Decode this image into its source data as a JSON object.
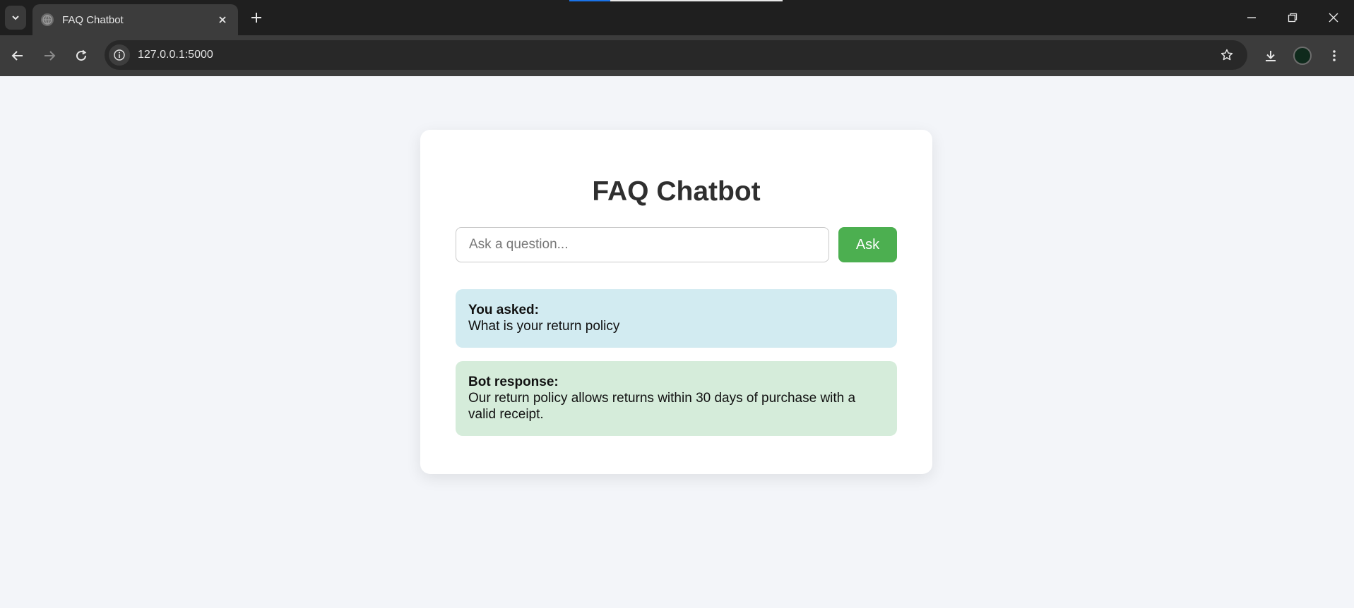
{
  "browser": {
    "tab_title": "FAQ Chatbot",
    "url": "127.0.0.1:5000",
    "icons": [
      "tab-search-icon",
      "globe-icon",
      "close-icon",
      "plus-icon",
      "minimize-icon",
      "restore-icon",
      "close-window-icon",
      "back-icon",
      "forward-icon",
      "reload-icon",
      "info-icon",
      "star-icon",
      "download-icon",
      "profile-avatar",
      "more-icon"
    ]
  },
  "app": {
    "title": "FAQ Chatbot",
    "input_placeholder": "Ask a question...",
    "input_value": "",
    "ask_label": "Ask",
    "user_label": "You asked:",
    "user_question": "What is your return policy",
    "bot_label": "Bot response:",
    "bot_answer": "Our return policy allows returns within 30 days of purchase with a valid receipt."
  },
  "colors": {
    "ask_button": "#4caf50",
    "user_bubble": "#d2ebf1",
    "bot_bubble": "#d5ecda",
    "page_background": "#f3f5f9"
  }
}
